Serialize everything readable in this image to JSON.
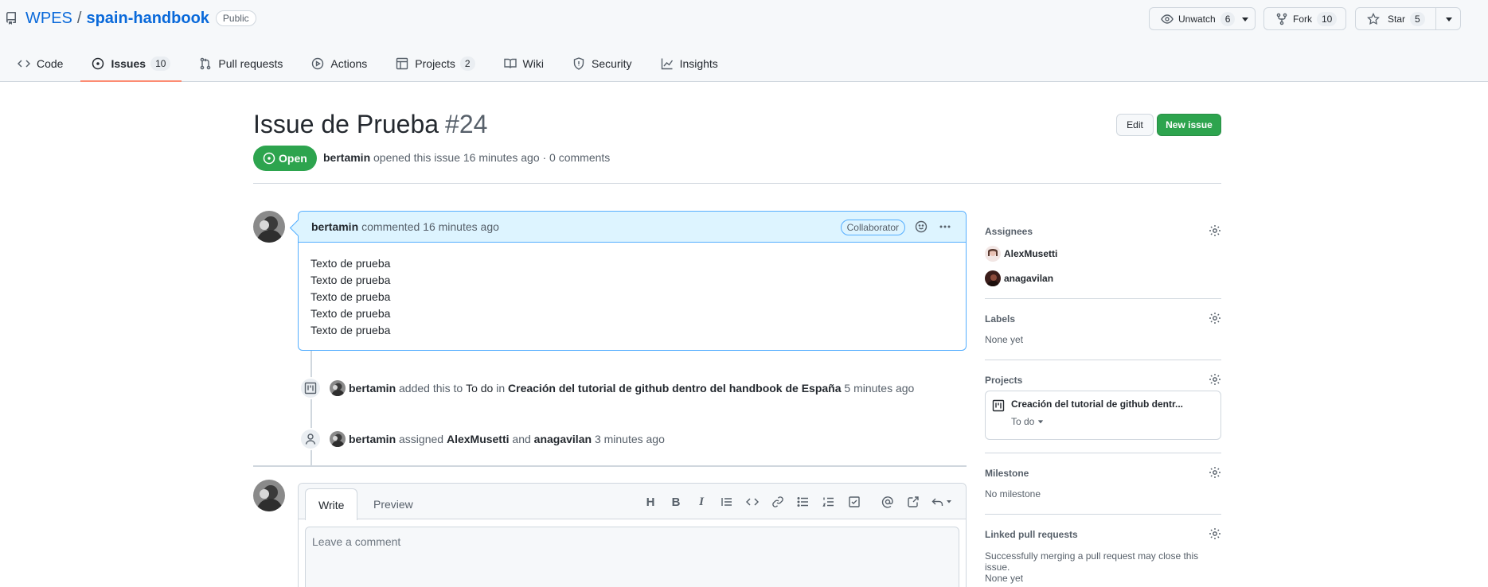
{
  "repo": {
    "owner": "WPES",
    "separator": "/",
    "name": "spain-handbook",
    "visibility": "Public"
  },
  "header_buttons": {
    "unwatch": {
      "label": "Unwatch",
      "count": "6"
    },
    "fork": {
      "label": "Fork",
      "count": "10"
    },
    "star": {
      "label": "Star",
      "count": "5"
    }
  },
  "tabs": [
    {
      "label": "Code",
      "icon": "code-icon"
    },
    {
      "label": "Issues",
      "count": "10",
      "icon": "issue-opened-icon",
      "active": true
    },
    {
      "label": "Pull requests",
      "icon": "git-pull-request-icon"
    },
    {
      "label": "Actions",
      "icon": "play-icon"
    },
    {
      "label": "Projects",
      "count": "2",
      "icon": "table-icon"
    },
    {
      "label": "Wiki",
      "icon": "book-icon"
    },
    {
      "label": "Security",
      "icon": "shield-icon"
    },
    {
      "label": "Insights",
      "icon": "graph-icon"
    }
  ],
  "issue": {
    "title": "Issue de Prueba",
    "number": "#24",
    "state": "Open",
    "author": "bertamin",
    "meta_rest": "opened this issue 16 minutes ago · 0 comments",
    "edit_label": "Edit",
    "new_issue_label": "New issue"
  },
  "comment": {
    "author": "bertamin",
    "time": "commented 16 minutes ago",
    "role": "Collaborator",
    "body": [
      "Texto de prueba",
      "Texto de prueba",
      "Texto de prueba",
      "Texto de prueba",
      "Texto de prueba"
    ]
  },
  "timeline": {
    "event1": {
      "actor": "bertamin",
      "text1": "added this to",
      "column": "To do",
      "text2": "in",
      "project": "Creación del tutorial de github dentro del handbook de España",
      "time": "5 minutes ago"
    },
    "event2": {
      "actor": "bertamin",
      "text1": "assigned",
      "user1": "AlexMusetti",
      "text2": "and",
      "user2": "anagavilan",
      "time": "3 minutes ago"
    }
  },
  "editor": {
    "write_tab": "Write",
    "preview_tab": "Preview",
    "placeholder": "Leave a comment",
    "toolbar": [
      "heading-icon",
      "bold-icon",
      "italic-icon",
      "quote-icon",
      "code-icon",
      "link-icon",
      "unordered-list-icon",
      "ordered-list-icon",
      "tasklist-icon",
      "mention-icon",
      "cross-reference-icon",
      "reply-icon"
    ]
  },
  "sidebar": {
    "assignees": {
      "title": "Assignees",
      "users": [
        "AlexMusetti",
        "anagavilan"
      ]
    },
    "labels": {
      "title": "Labels",
      "value": "None yet"
    },
    "projects": {
      "title": "Projects",
      "project_name": "Creación del tutorial de github dentr...",
      "column": "To do"
    },
    "milestone": {
      "title": "Milestone",
      "value": "No milestone"
    },
    "linked_prs": {
      "title": "Linked pull requests",
      "description": "Successfully merging a pull request may close this issue.",
      "value": "None yet"
    }
  },
  "colors": {
    "accent": "#0969da",
    "open_green": "#2da44e",
    "tab_underline": "#fd8c73",
    "comment_header": "#ddf4ff"
  }
}
